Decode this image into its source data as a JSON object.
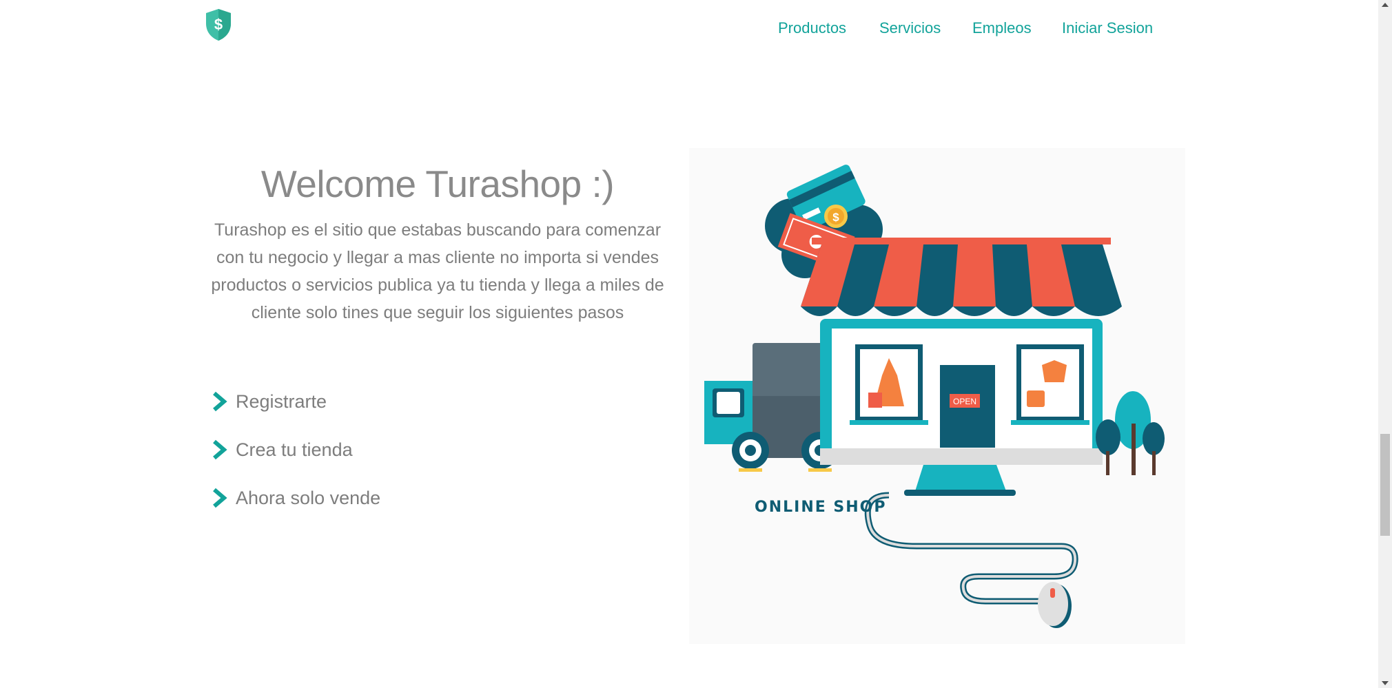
{
  "colors": {
    "accent": "#12a39a",
    "text": "#7d7d7d",
    "title": "#8a8a8a"
  },
  "header": {
    "logo_icon": "dollar-shield-icon",
    "nav": [
      {
        "label": "Productos"
      },
      {
        "label": "Servicios"
      },
      {
        "label": "Empleos"
      },
      {
        "label": "Iniciar Sesion"
      }
    ]
  },
  "hero": {
    "title": "Welcome Turashop :)",
    "description": "Turashop es el sitio que estabas buscando para comenzar con tu negocio y llegar a mas cliente no importa si vendes productos o servicios publica ya tu tienda y llega a miles de cliente solo tines que seguir los siguientes pasos",
    "step_icon": "chevron-right-icon",
    "steps": [
      {
        "label": "Registrarte"
      },
      {
        "label": "Crea tu tienda"
      },
      {
        "label": "Ahora solo vende"
      }
    ]
  },
  "illustration": {
    "caption": "ONLINE SHOP",
    "door_sign": "OPEN",
    "coin_symbol": "$"
  }
}
